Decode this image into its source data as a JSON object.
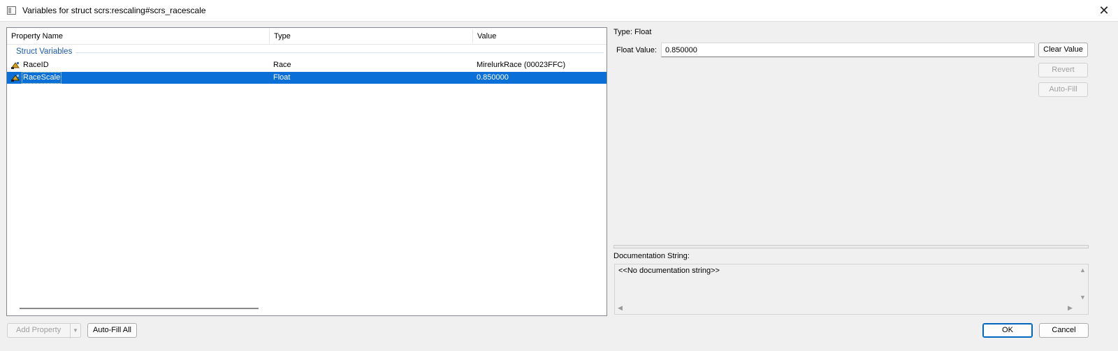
{
  "window": {
    "title": "Variables for struct scrs:rescaling#scrs_racescale",
    "close_glyph": "✕"
  },
  "tree": {
    "columns": [
      "Property Name",
      "Type",
      "Value"
    ],
    "group_label": "Struct Variables",
    "rows": [
      {
        "name": "RaceID",
        "type": "Race",
        "value": "MirelurkRace (00023FFC)",
        "selected": false
      },
      {
        "name": "RaceScale",
        "type": "Float",
        "value": "0.850000",
        "selected": true
      }
    ]
  },
  "editor": {
    "type_label": "Type: Float",
    "float_label": "Float Value:",
    "float_value": "0.850000",
    "clear_button": "Clear Value",
    "revert_button": "Revert",
    "autofill_button": "Auto-Fill"
  },
  "documentation": {
    "label": "Documentation String:",
    "text": "<<No documentation string>>"
  },
  "footer": {
    "add_property_button": "Add Property",
    "autofill_all_button": "Auto-Fill All",
    "ok_button": "OK",
    "cancel_button": "Cancel"
  },
  "colors": {
    "selection": "#0a6fd6",
    "group_label": "#1e5aa8",
    "default_button_border": "#0067c0"
  },
  "icons": {
    "row_icon": "script-property-icon",
    "window_icon": "window-icon"
  }
}
